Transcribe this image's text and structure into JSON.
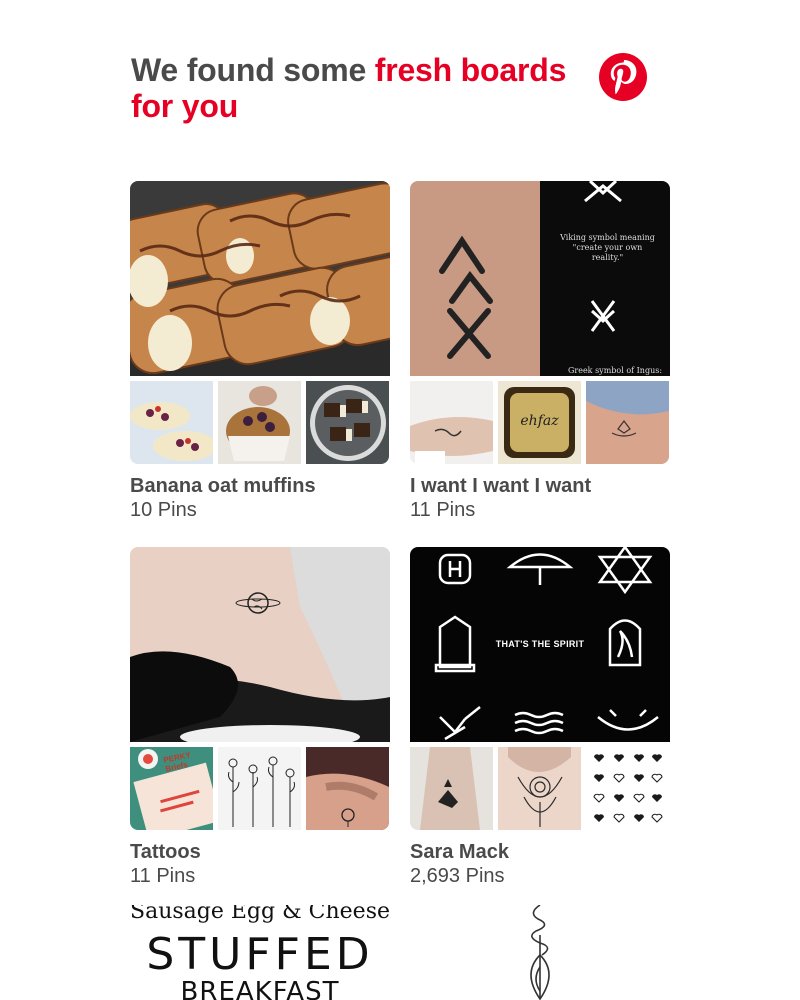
{
  "header": {
    "headline_part1": "We found some ",
    "headline_part2": "fresh boards for you",
    "logo_icon": "pinterest-logo-icon",
    "accent_color": "#e60023",
    "text_color": "#4a4a4a"
  },
  "boards": [
    {
      "name": "Banana oat muffins",
      "count": "10 Pins"
    },
    {
      "name": "I want I want I want",
      "count": "11 Pins",
      "cover_texts": {
        "meaning": "Viking symbol meaning\n\"create your own reality.\"",
        "caption": "Greek symbol of Ingus:"
      },
      "thumb_text": "ehfaz"
    },
    {
      "name": "Tattoos",
      "count": "11 Pins",
      "thumb_text": "PERKY\nBriefs"
    },
    {
      "name": "Sara Mack",
      "count": "2,693 Pins",
      "cover_text": "THAT'S THE SPIRIT"
    }
  ],
  "teasers": [
    {
      "line1": "Sausage Egg & Cheese",
      "line2": "STUFFED",
      "line3": "BREAKFAST BISCUITS"
    },
    {
      "icon": "lotus-line-tattoo-icon"
    }
  ]
}
